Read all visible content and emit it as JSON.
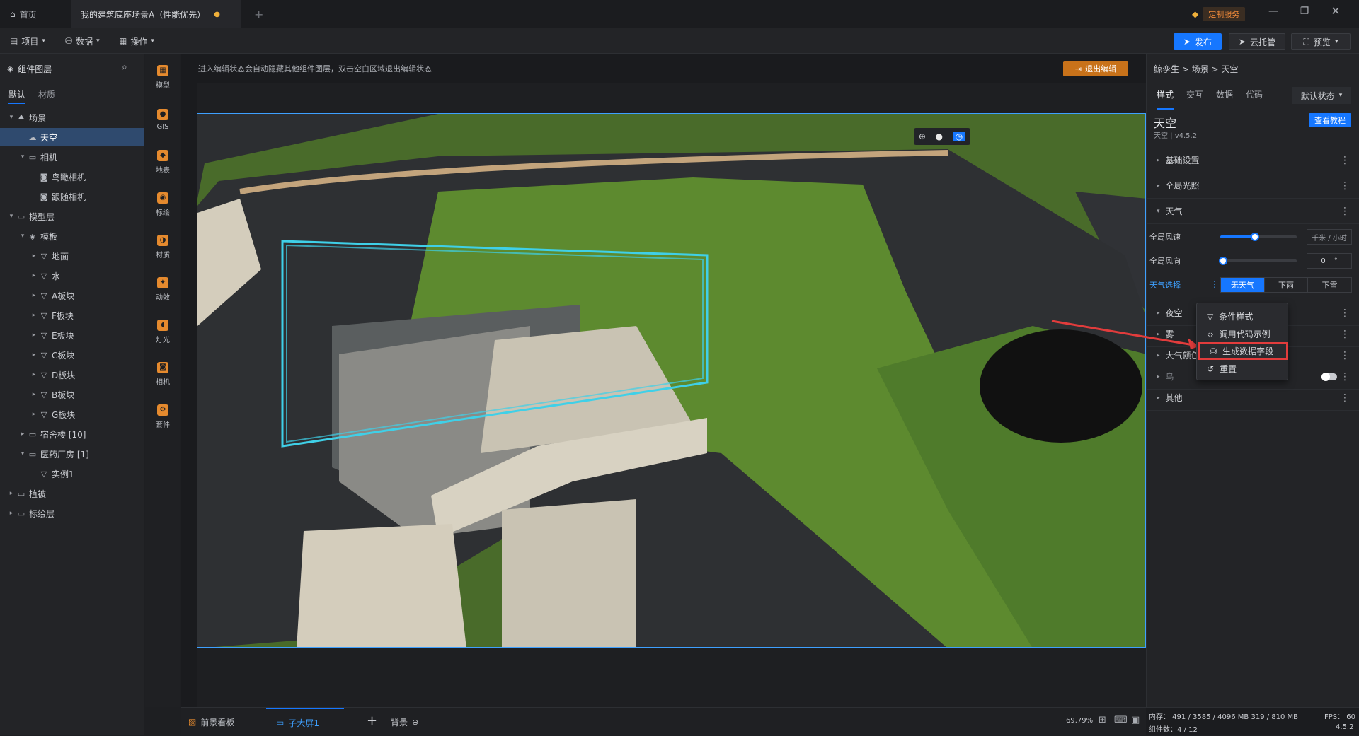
{
  "titlebar": {
    "home_tab": "首页",
    "scene_tab": "我的建筑底座场景A（性能优先）",
    "custom_service": "定制服务"
  },
  "toolbar": {
    "menu_project": "项目",
    "menu_data": "数据",
    "menu_operate": "操作",
    "publish": "发布",
    "cloud": "云托管",
    "preview": "预览"
  },
  "leftpanel": {
    "title": "组件图层",
    "tab_default": "默认",
    "tab_material": "材质",
    "tree": [
      {
        "label": "场景",
        "depth": 0,
        "arrow": "▾",
        "icon": "⛰"
      },
      {
        "label": "天空",
        "depth": 1,
        "arrow": "",
        "icon": "☁"
      },
      {
        "label": "相机",
        "depth": 1,
        "arrow": "▾",
        "icon": "▭"
      },
      {
        "label": "鸟瞰相机",
        "depth": 2,
        "arrow": "",
        "icon": "◙"
      },
      {
        "label": "跟随相机",
        "depth": 2,
        "arrow": "",
        "icon": "◙"
      },
      {
        "label": "模型层",
        "depth": 0,
        "arrow": "▾",
        "icon": "▭"
      },
      {
        "label": "模板",
        "depth": 1,
        "arrow": "▾",
        "icon": "◈"
      },
      {
        "label": "地面",
        "depth": 2,
        "arrow": "▸",
        "icon": "▽"
      },
      {
        "label": "水",
        "depth": 2,
        "arrow": "▸",
        "icon": "▽"
      },
      {
        "label": "A板块",
        "depth": 2,
        "arrow": "▸",
        "icon": "▽"
      },
      {
        "label": "F板块",
        "depth": 2,
        "arrow": "▸",
        "icon": "▽"
      },
      {
        "label": "E板块",
        "depth": 2,
        "arrow": "▸",
        "icon": "▽"
      },
      {
        "label": "C板块",
        "depth": 2,
        "arrow": "▸",
        "icon": "▽"
      },
      {
        "label": "D板块",
        "depth": 2,
        "arrow": "▸",
        "icon": "▽"
      },
      {
        "label": "B板块",
        "depth": 2,
        "arrow": "▸",
        "icon": "▽"
      },
      {
        "label": "G板块",
        "depth": 2,
        "arrow": "▸",
        "icon": "▽"
      },
      {
        "label": "宿舍楼 [10]",
        "depth": 1,
        "arrow": "▸",
        "icon": "▭"
      },
      {
        "label": "医药厂房 [1]",
        "depth": 1,
        "arrow": "▾",
        "icon": "▭"
      },
      {
        "label": "实例1",
        "depth": 2,
        "arrow": "",
        "icon": "▽"
      },
      {
        "label": "植被",
        "depth": 0,
        "arrow": "▸",
        "icon": "▭"
      },
      {
        "label": "标绘层",
        "depth": 0,
        "arrow": "▸",
        "icon": "▭"
      }
    ]
  },
  "iconbar": [
    "模型",
    "GIS",
    "地表",
    "标绘",
    "材质",
    "动效",
    "灯光",
    "相机",
    "套件"
  ],
  "canvas": {
    "hint": "进入编辑状态会自动隐藏其他组件图层，双击空白区域退出编辑状态",
    "exit_edit": "退出编辑"
  },
  "status": {
    "tab_foreground": "前景看板",
    "tab_subscreen": "子大屏1",
    "tab_background": "背景",
    "zoom": "69.79%"
  },
  "rightpanel": {
    "breadcrumb": "鲸孪生 > 场景 > 天空",
    "tabs": [
      "样式",
      "交互",
      "数据",
      "代码"
    ],
    "state": "默认状态",
    "component_title": "天空",
    "component_sub": "天空 | v4.5.2",
    "tutorial": "查看教程",
    "sections": [
      "基础设置",
      "全局光照",
      "天气",
      "夜空",
      "雾",
      "大气颜色",
      "鸟",
      "其他"
    ],
    "wind_speed_label": "全局风速",
    "wind_speed_unit": "千米 / 小时",
    "wind_speed_level": 0.45,
    "wind_dir_label": "全局风向",
    "wind_dir_value": "0",
    "wind_dir_unit": "°",
    "weather_label": "天气选择",
    "weather_options": [
      "无天气",
      "下雨",
      "下雪"
    ]
  },
  "context_menu": [
    "条件样式",
    "调用代码示例",
    "生成数据字段",
    "重置"
  ],
  "bottombar": {
    "memory": "内存： 491 / 3585 / 4096 MB  319 / 810 MB",
    "fps": "FPS： 60",
    "count": "组件数：4 / 12",
    "version": "4.5.2"
  },
  "colors": {
    "accent": "#1677ff",
    "highlight": "#e23c3c",
    "exit_btn": "#c8721a"
  }
}
